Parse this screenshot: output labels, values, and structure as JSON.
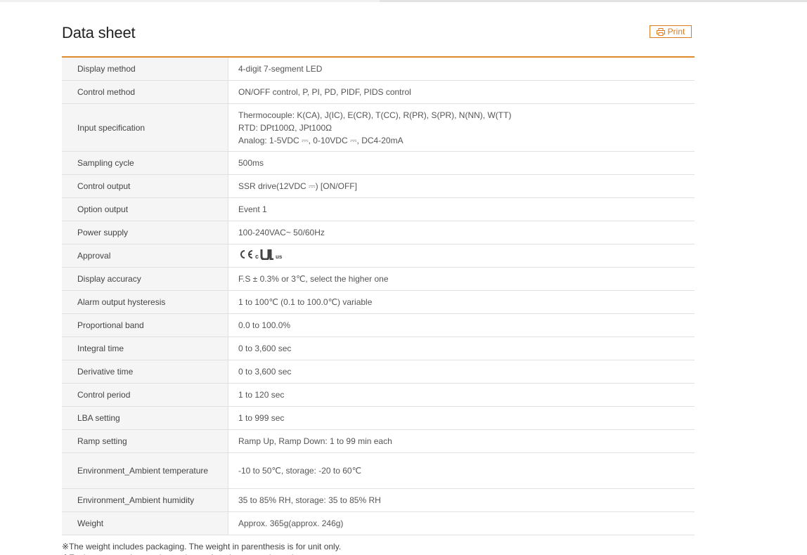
{
  "page": {
    "title": "Data sheet",
    "print_label": "Print"
  },
  "specs": [
    {
      "label": "Display method",
      "value": [
        "4-digit 7-segment LED"
      ]
    },
    {
      "label": "Control method",
      "value": [
        "ON/OFF control, P, PI, PD, PIDF, PIDS control"
      ]
    },
    {
      "label": "Input specification",
      "value": [
        "Thermocouple: K(CA), J(IC), E(CR), T(CC), R(PR), S(PR), N(NN), W(TT)",
        "RTD: DPt100Ω, JPt100Ω",
        "Analog: 1-5VDC ⎓, 0-10VDC ⎓, DC4-20mA"
      ]
    },
    {
      "label": "Sampling cycle",
      "value": [
        "500ms"
      ]
    },
    {
      "label": "Control output",
      "value": [
        "SSR drive(12VDC ⎓) [ON/OFF]"
      ]
    },
    {
      "label": "Option output",
      "value": [
        "Event 1"
      ]
    },
    {
      "label": "Power supply",
      "value": [
        "100-240VAC~ 50/60Hz"
      ]
    },
    {
      "label": "Approval",
      "value": []
    },
    {
      "label": "Display accuracy",
      "value": [
        "F.S ± 0.3% or 3℃, select the higher one"
      ]
    },
    {
      "label": "Alarm output hysteresis",
      "value": [
        "1 to 100℃ (0.1 to 100.0℃) variable"
      ]
    },
    {
      "label": "Proportional band",
      "value": [
        "0.0 to 100.0%"
      ]
    },
    {
      "label": "Integral time",
      "value": [
        "0 to 3,600 sec"
      ]
    },
    {
      "label": "Derivative time",
      "value": [
        "0 to 3,600 sec"
      ]
    },
    {
      "label": "Control period",
      "value": [
        "1 to 120 sec"
      ]
    },
    {
      "label": "LBA setting",
      "value": [
        "1 to 999 sec"
      ]
    },
    {
      "label": "Ramp setting",
      "value": [
        "Ramp Up, Ramp Down: 1 to 99 min each"
      ]
    },
    {
      "label": "Environment_Ambient temperature",
      "value": [
        "-10 to 50℃, storage: -20 to 60℃"
      ]
    },
    {
      "label": "Environment_Ambient humidity",
      "value": [
        "35 to 85% RH, storage: 35 to 85% RH"
      ]
    },
    {
      "label": "Weight",
      "value": [
        "Approx. 365g(approx. 246g)"
      ]
    }
  ],
  "approval_marks": {
    "ce": "CE",
    "ul_c": "c",
    "ul_us": "us"
  },
  "notes": [
    "※The weight includes packaging. The weight in parenthesis is for unit only.",
    "※Environment resistance is rated at no freezing or condensation."
  ],
  "colors": {
    "accent": "#e08a2e",
    "print": "#d97b1e",
    "label_bg": "#f5f5f5"
  },
  "icons": {
    "print": "printer-icon"
  }
}
